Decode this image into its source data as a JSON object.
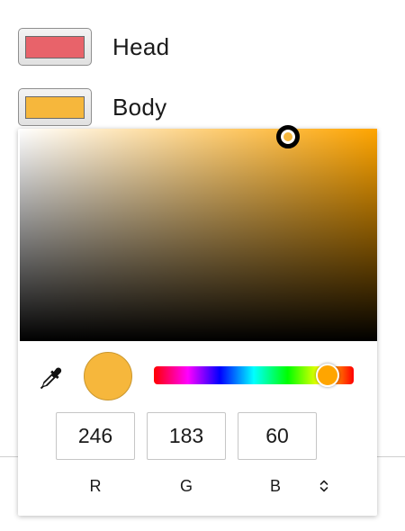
{
  "color_rows": [
    {
      "label": "Head",
      "color": "#e8636a"
    },
    {
      "label": "Body",
      "color": "#f6b73c"
    }
  ],
  "picker": {
    "hue_color": "#ffa500",
    "current_color": "#f6b73c",
    "saturation": 0.75,
    "brightness": 0.96,
    "hue_position": 0.87,
    "rgb": {
      "r": {
        "label": "R",
        "value": "246"
      },
      "g": {
        "label": "G",
        "value": "183"
      },
      "b": {
        "label": "B",
        "value": "60"
      }
    },
    "icons": {
      "eyedropper": "eyedropper-icon",
      "mode_toggle": "chevron-up-down-icon"
    }
  }
}
